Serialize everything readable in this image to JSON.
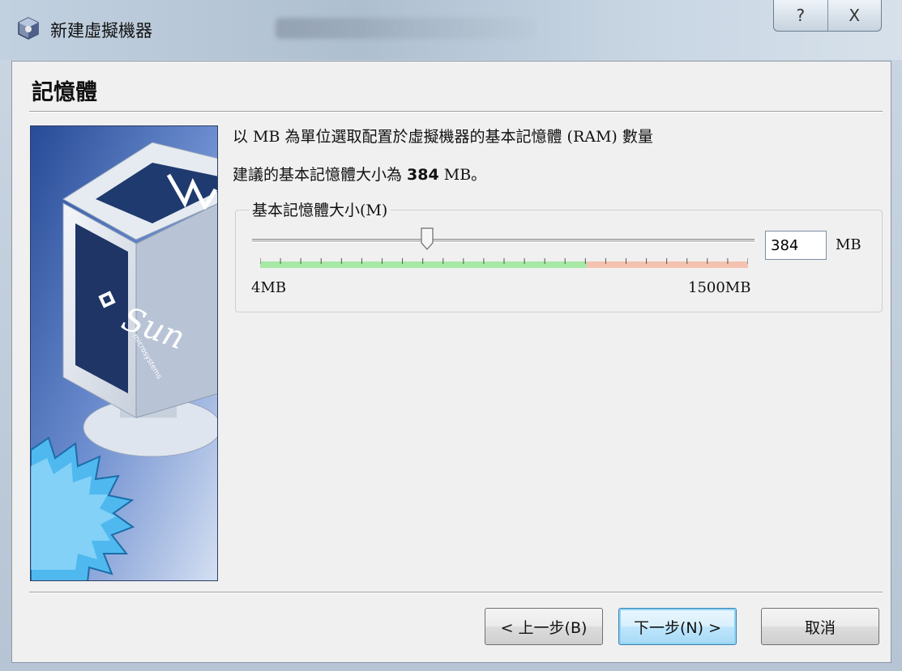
{
  "window": {
    "title": "新建虛擬機器",
    "help_glyph": "?",
    "close_glyph": "X"
  },
  "page": {
    "heading": "記憶體",
    "description": "以 MB 為單位選取配置於虛擬機器的基本記憶體 (RAM) 數量",
    "recommend_prefix": "建議的基本記憶體大小為 ",
    "recommend_value": "384",
    "recommend_suffix": " MB。"
  },
  "memory": {
    "group_label": "基本記憶體大小(M)",
    "value": "384",
    "unit": "MB",
    "min_label": "4MB",
    "max_label": "1500MB",
    "min_mb": 4,
    "max_mb": 1500,
    "recommended_max_fraction": 0.67,
    "current_mb": 384
  },
  "buttons": {
    "back": "< 上一步(B)",
    "next": "下一步(N) >",
    "cancel": "取消"
  },
  "side_logo": {
    "brand": "Sun",
    "sub": "microsystems"
  },
  "colors": {
    "safe_zone": "#a6e8a6",
    "warn_zone": "#f4c2b0",
    "accent": "#3c7fb1"
  }
}
